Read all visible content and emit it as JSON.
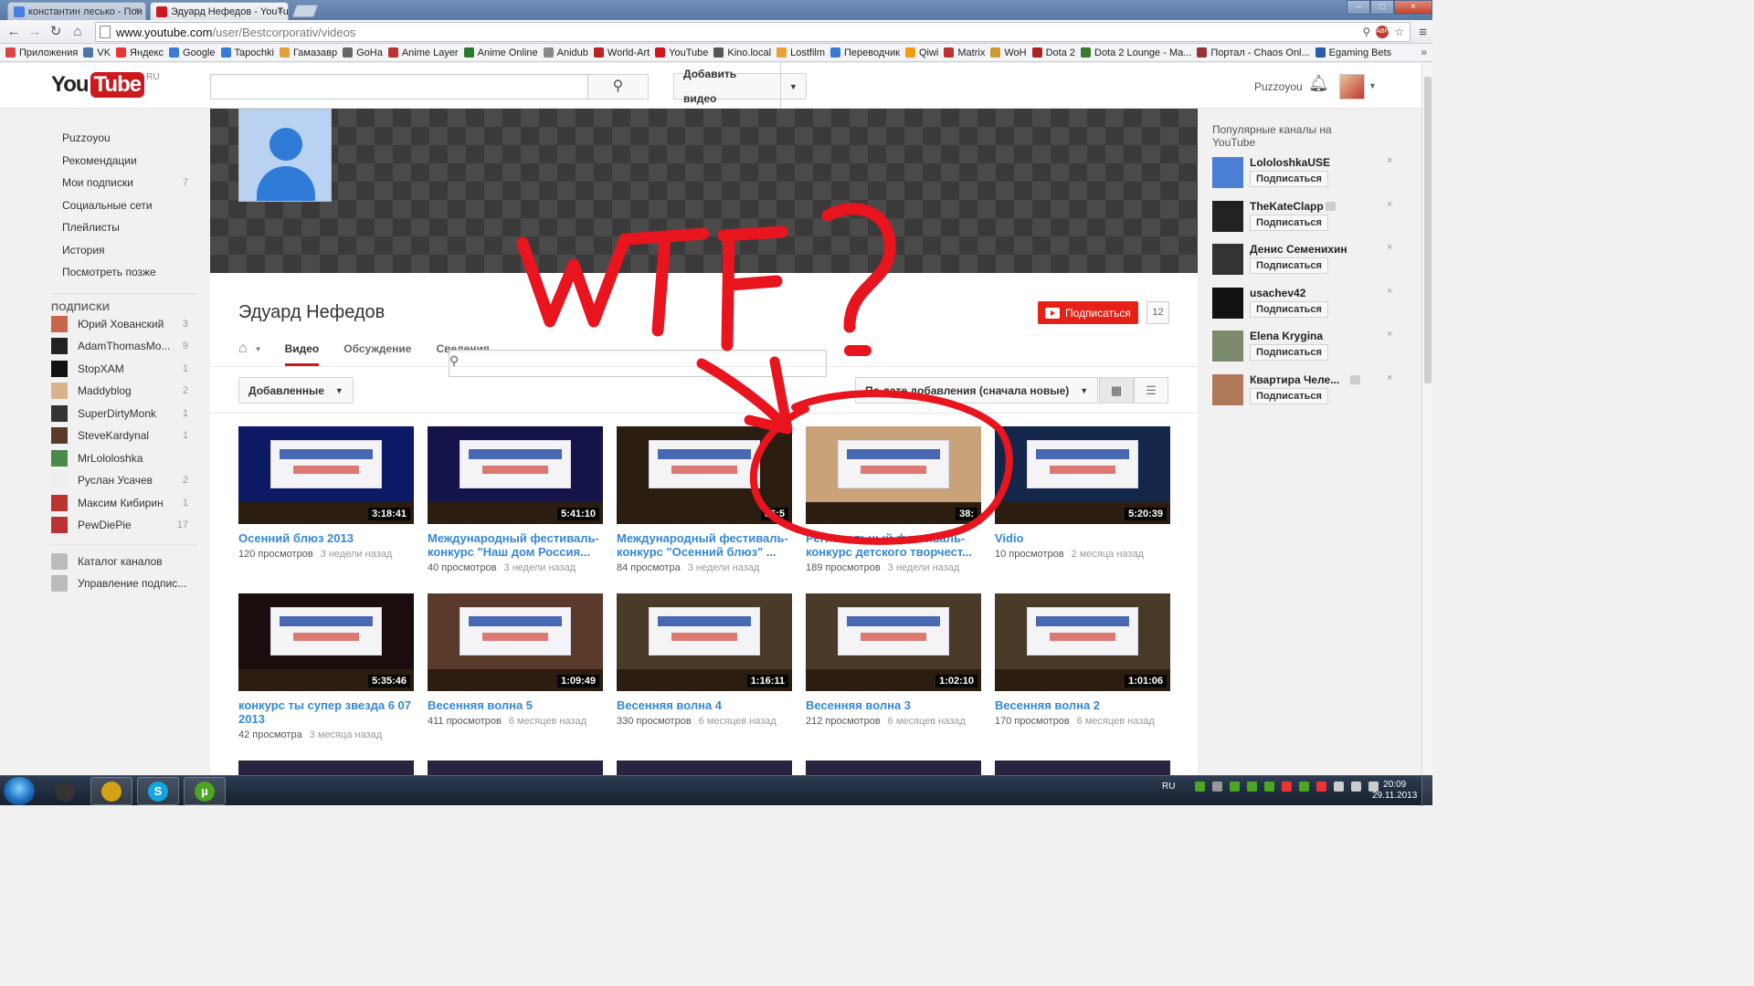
{
  "browser": {
    "tabs": [
      {
        "title": "константин лесько - Пои",
        "active": false,
        "favicon_color": "#4a7fe0"
      },
      {
        "title": "Эдуард Нефедов - YouTu",
        "active": true,
        "favicon_color": "#cc181e"
      }
    ],
    "url_host": "www.youtube.com",
    "url_path": "/user/Bestcorporativ/videos",
    "toolbar_icons": [
      "back-icon",
      "forward-icon",
      "reload-icon",
      "home-icon"
    ],
    "bookmarks": [
      {
        "label": "Приложения",
        "color": "#d44"
      },
      {
        "label": "VK",
        "color": "#4c75a3"
      },
      {
        "label": "Яндекс",
        "color": "#e33"
      },
      {
        "label": "Google",
        "color": "#3a7bd5"
      },
      {
        "label": "Tapochki",
        "color": "#3a7bd5"
      },
      {
        "label": "Гамазавр",
        "color": "#e6a03a"
      },
      {
        "label": "GoHa",
        "color": "#666"
      },
      {
        "label": "Anime Layer",
        "color": "#b33"
      },
      {
        "label": "Anime Online",
        "color": "#2a7a2a"
      },
      {
        "label": "Anidub",
        "color": "#888"
      },
      {
        "label": "World-Art",
        "color": "#b22"
      },
      {
        "label": "YouTube",
        "color": "#cc181e"
      },
      {
        "label": "Kino.local",
        "color": "#555"
      },
      {
        "label": "Lostfilm",
        "color": "#e6a03a"
      },
      {
        "label": "Переводчик",
        "color": "#3a7bd5"
      },
      {
        "label": "Qiwi",
        "color": "#f39c12"
      },
      {
        "label": "Matrix",
        "color": "#b33"
      },
      {
        "label": "WoH",
        "color": "#c93"
      },
      {
        "label": "Dota 2",
        "color": "#a22"
      },
      {
        "label": "Dota 2 Lounge - Ma...",
        "color": "#3a7a2a"
      },
      {
        "label": "Портал - Chaos Onl...",
        "color": "#933"
      },
      {
        "label": "Egaming Bets",
        "color": "#2a5aa8"
      }
    ],
    "bookmarks_more": "»"
  },
  "masthead": {
    "logo_you": "You",
    "logo_tube": "Tube",
    "logo_region": "RU",
    "search_placeholder": "",
    "upload_label": "Добавить видео",
    "username": "Puzzoyou"
  },
  "guide": {
    "main_items": [
      {
        "label": "Puzzoyou",
        "count": ""
      },
      {
        "label": "Рекомендации",
        "count": ""
      },
      {
        "label": "Мои подписки",
        "count": "7"
      },
      {
        "label": "Социальные сети",
        "count": ""
      },
      {
        "label": "Плейлисты",
        "count": ""
      },
      {
        "label": "История",
        "count": ""
      },
      {
        "label": "Посмотреть позже",
        "count": ""
      }
    ],
    "subs_heading": "ПОДПИСКИ",
    "subscriptions": [
      {
        "label": "Юрий Хованский",
        "count": "3",
        "color": "#c9664a"
      },
      {
        "label": "AdamThomasMo...",
        "count": "9",
        "color": "#222"
      },
      {
        "label": "StopXAM",
        "count": "1",
        "color": "#111"
      },
      {
        "label": "Maddyblog",
        "count": "2",
        "color": "#d9b48a"
      },
      {
        "label": "SuperDirtyMonk",
        "count": "1",
        "color": "#333"
      },
      {
        "label": "SteveKardynal",
        "count": "1",
        "color": "#5a3a2a"
      },
      {
        "label": "MrLololoshka",
        "count": "",
        "color": "#4a8a4a"
      },
      {
        "label": "Руслан Усачев",
        "count": "2",
        "color": "#eee"
      },
      {
        "label": "Максим Кибирин",
        "count": "1",
        "color": "#b33"
      },
      {
        "label": "PewDiePie",
        "count": "17",
        "color": "#b33"
      }
    ],
    "footer_items": [
      {
        "label": "Каталог каналов",
        "icon": "plus-circle-icon"
      },
      {
        "label": "Управление подпис...",
        "icon": "gear-icon"
      }
    ]
  },
  "channel": {
    "name": "Эдуард Нефедов",
    "subscribe_label": "Подписаться",
    "subscriber_count": "12",
    "tabs": [
      {
        "label": "Видео",
        "active": true
      },
      {
        "label": "Обсуждение",
        "active": false
      },
      {
        "label": "Сведения",
        "active": false
      }
    ],
    "filter_label": "Добавленные",
    "sort_label": "По дате добавления (сначала новые)"
  },
  "videos": [
    {
      "title": "Осенний блюз 2013",
      "views": "120 просмотров",
      "ago": "3 недели назад",
      "duration": "3:18:41",
      "bg": "#0d1a66"
    },
    {
      "title": "Международный фестиваль-конкурс \"Наш дом Россия...",
      "views": "40 просмотров",
      "ago": "3 недели назад",
      "duration": "5:41:10",
      "bg": "#14134a"
    },
    {
      "title": "Международный фестиваль-конкурс \"Осенний блюз\" ...",
      "views": "84 просмотра",
      "ago": "3 недели назад",
      "duration": "36:5",
      "bg": "#2b1e10"
    },
    {
      "title": "Региональный фестиваль-конкурс детского творчест...",
      "views": "189 просмотров",
      "ago": "3 недели назад",
      "duration": "38:",
      "bg": "#c9a27a"
    },
    {
      "title": "Vidio",
      "views": "10 просмотров",
      "ago": "2 месяца назад",
      "duration": "5:20:39",
      "bg": "#14264a"
    },
    {
      "title": "конкурс ты супер звезда 6 07 2013",
      "views": "42 просмотра",
      "ago": "3 месяца назад",
      "duration": "5:35:46",
      "bg": "#1a0d0d"
    },
    {
      "title": "Весенняя волна 5",
      "views": "411 просмотров",
      "ago": "6 месяцев назад",
      "duration": "1:09:49",
      "bg": "#5a3a2a"
    },
    {
      "title": "Весенняя волна 4",
      "views": "330 просмотров",
      "ago": "6 месяцев назад",
      "duration": "1:16:11",
      "bg": "#4a3a2a"
    },
    {
      "title": "Весенняя волна 3",
      "views": "212 просмотров",
      "ago": "6 месяцев назад",
      "duration": "1:02:10",
      "bg": "#4a3a2a"
    },
    {
      "title": "Весенняя волна 2",
      "views": "170 просмотров",
      "ago": "6 месяцев назад",
      "duration": "1:01:06",
      "bg": "#4a3a2a"
    }
  ],
  "rail": {
    "title": "Популярные каналы на YouTube",
    "subscribe_label": "Подписаться",
    "channels": [
      {
        "name": "LololoshkaUSE",
        "verified": false,
        "color": "#4a7fd5"
      },
      {
        "name": "TheKateClapp",
        "verified": true,
        "color": "#222"
      },
      {
        "name": "Денис Семенихин",
        "verified": false,
        "color": "#333"
      },
      {
        "name": "usachev42",
        "verified": false,
        "color": "#111"
      },
      {
        "name": "Elena Krygina",
        "verified": false,
        "color": "#7a8a6a"
      },
      {
        "name": "Квартира Челе...",
        "verified": true,
        "color": "#b07a5a"
      }
    ]
  },
  "annotation": {
    "text": "WTF?",
    "color": "#e8141e"
  },
  "taskbar": {
    "pinned": [
      {
        "name": "media-player",
        "color": "#333"
      },
      {
        "name": "chrome",
        "color": "#d4a014"
      },
      {
        "name": "skype",
        "color": "#12a5e0"
      },
      {
        "name": "utorrent",
        "color": "#4aa820"
      }
    ],
    "lang": "RU",
    "time": "20:09",
    "date": "29.11.2013"
  }
}
